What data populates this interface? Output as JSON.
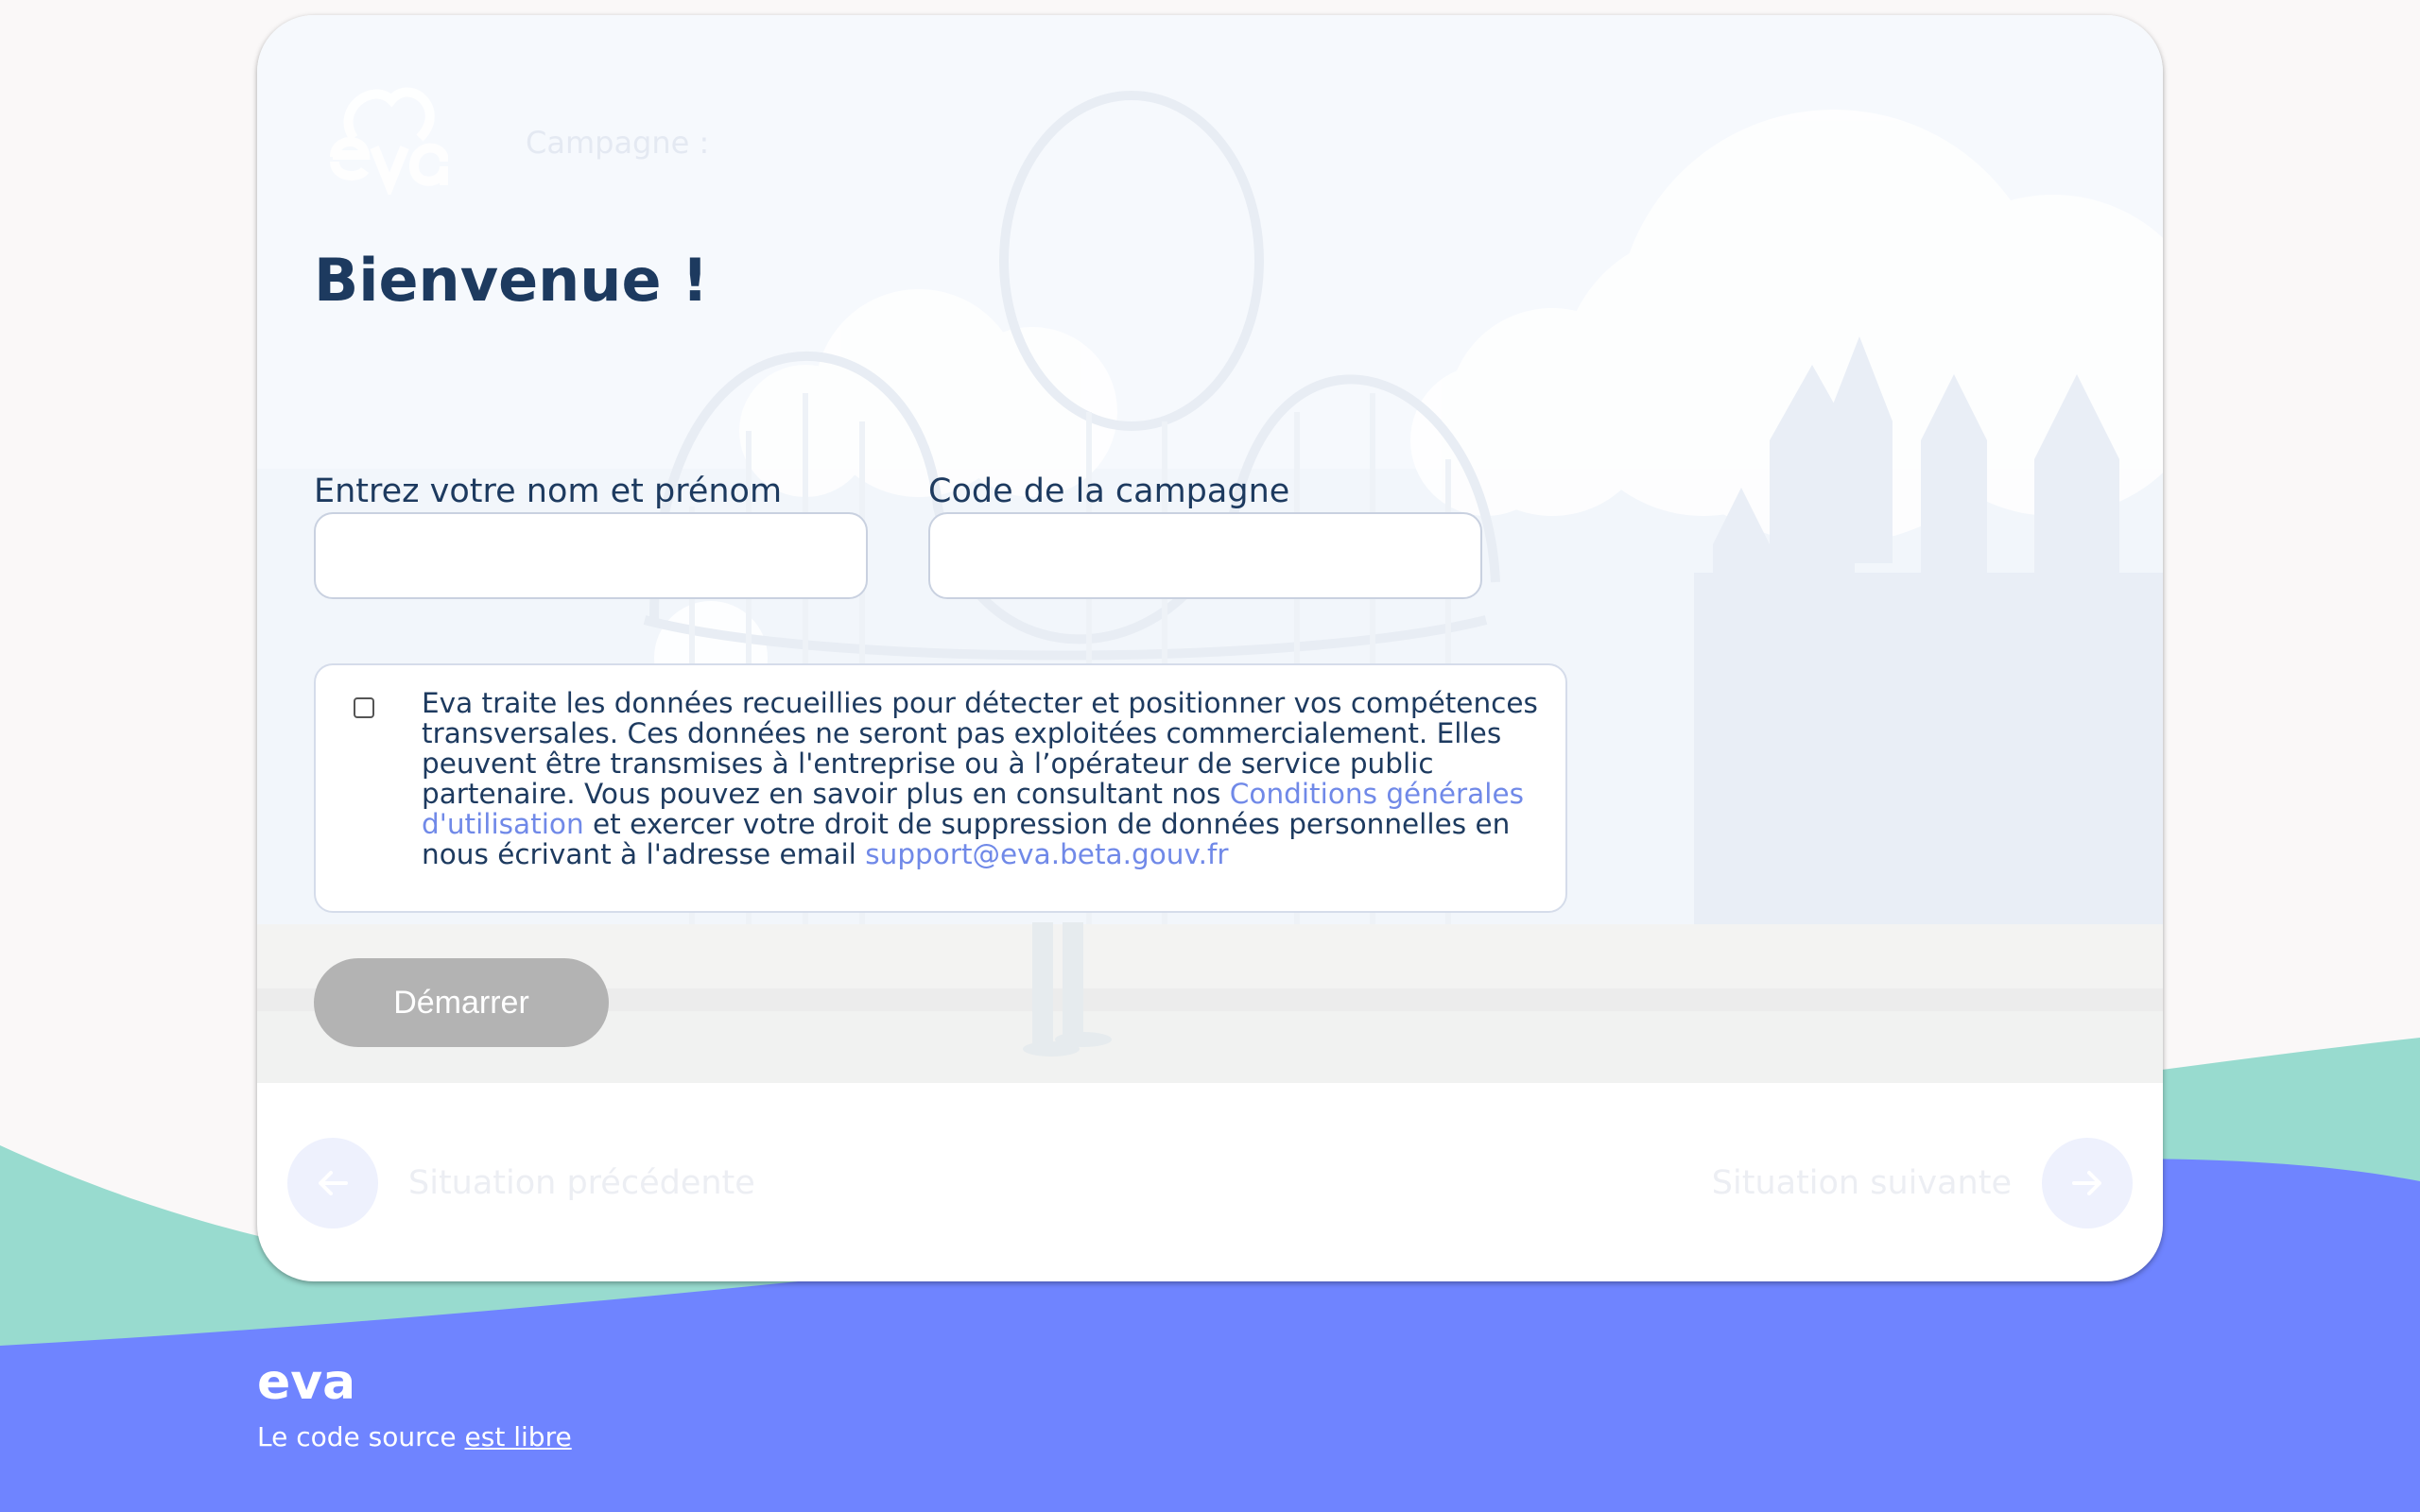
{
  "header": {
    "logo_icon": "eva-logo",
    "campaign_label": "Campagne :"
  },
  "main": {
    "title": "Bienvenue !",
    "name_label": "Entrez votre nom et prénom",
    "name_value": "",
    "campaign_code_label": "Code de la campagne",
    "campaign_code_value": "",
    "consent": {
      "checked": false,
      "text_before_link": "Eva traite les données recueillies pour détecter et positionner vos compétences transversales. Ces données ne seront pas exploitées commercialement. Elles peuvent être transmises à l'entreprise ou à l’opérateur de service public partenaire. Vous pouvez en savoir plus en consultant nos ",
      "terms_link": "Conditions générales d'utilisation",
      "text_middle": " et exercer votre droit de suppression de données personnelles en nous écrivant à l'adresse email ",
      "email_link": "support@eva.beta.gouv.fr"
    },
    "start_button": "Démarrer"
  },
  "navigation": {
    "previous_label": "Situation précédente",
    "previous_icon": "arrow-left-icon",
    "next_label": "Situation suivante",
    "next_icon": "arrow-right-icon"
  },
  "footer": {
    "logo_text": "eva",
    "source_text": "Le code source ",
    "source_link": "est libre"
  },
  "colors": {
    "primary_dark": "#1d3a5f",
    "accent_blue": "#6f84ff",
    "accent_teal": "#98dbcf",
    "button_disabled": "#b3b3b3",
    "link": "#7089e8"
  }
}
